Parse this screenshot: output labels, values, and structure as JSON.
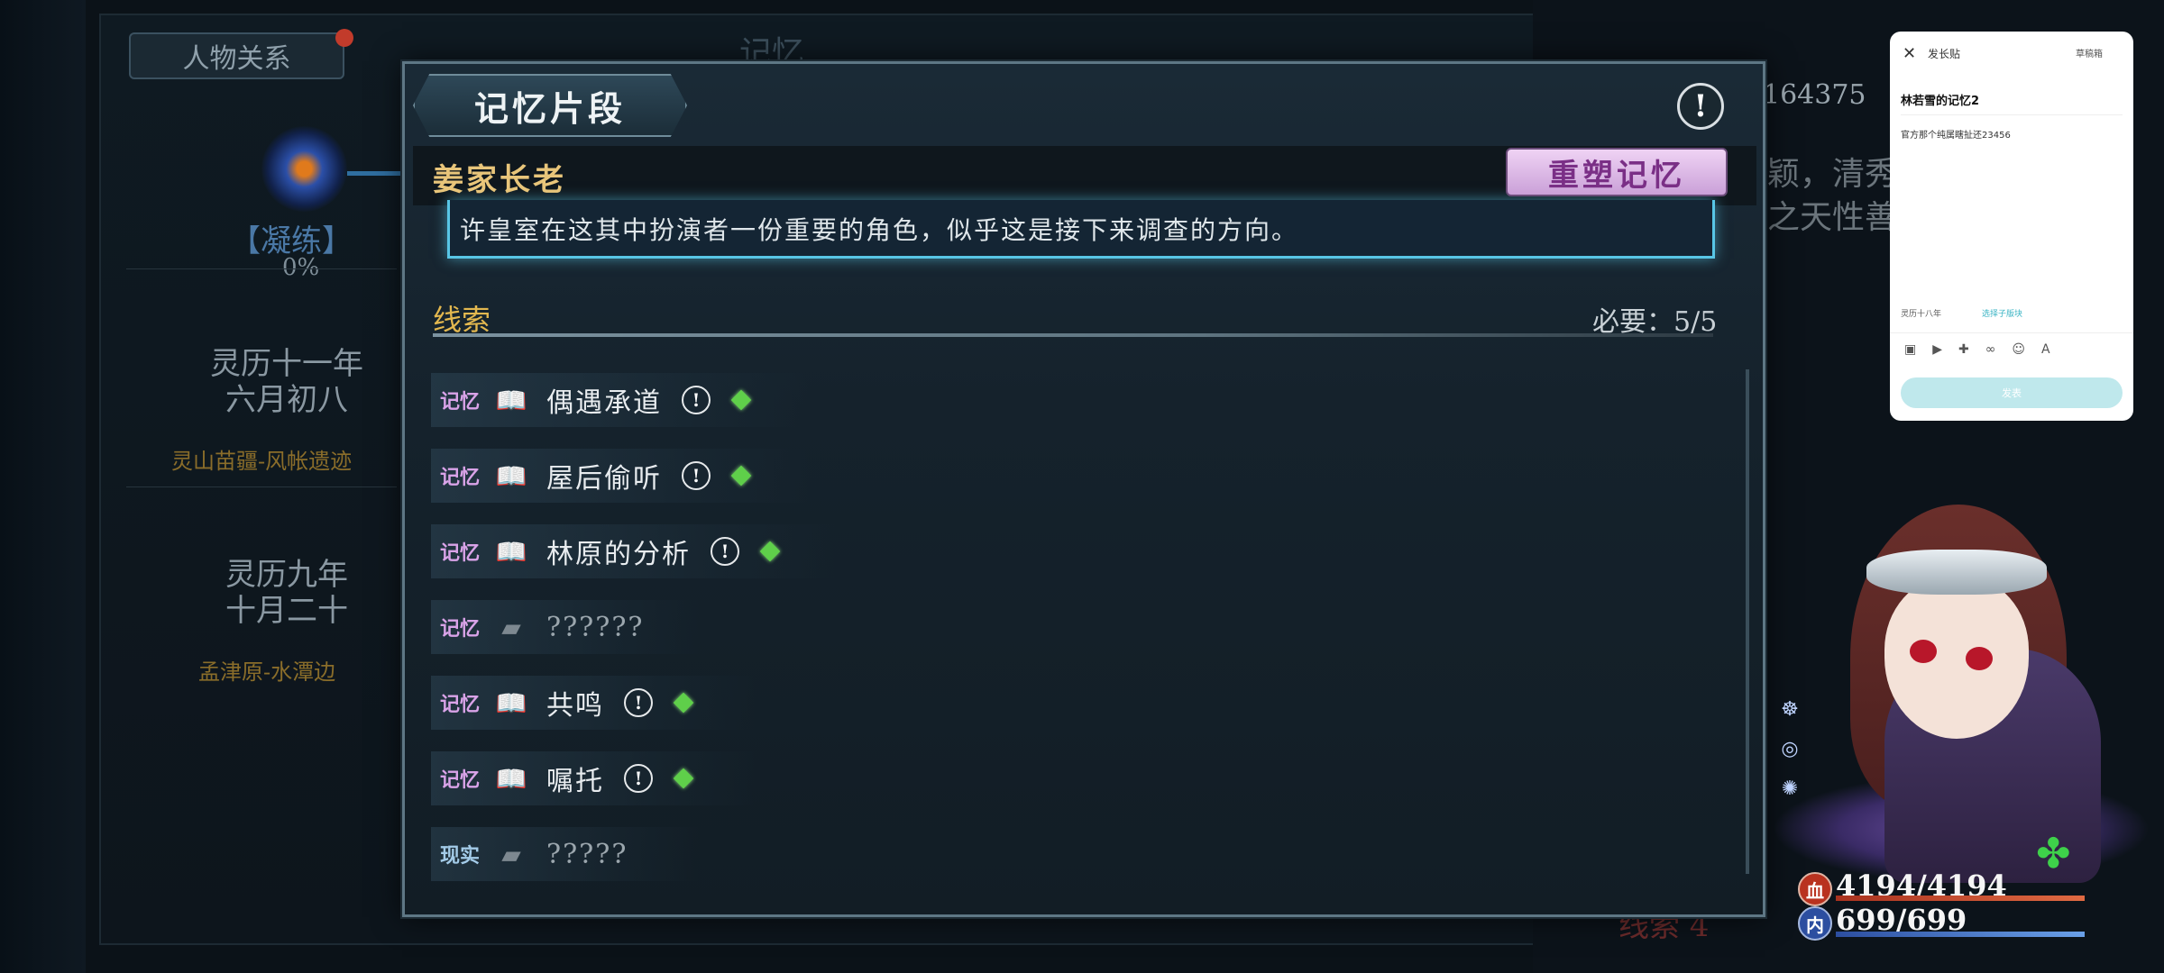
{
  "background": {
    "relations_tab": "人物关系",
    "title": "记忆",
    "condense_label": "【凝练】",
    "condense_percent": "0%",
    "events": [
      {
        "date_line1": "灵历十一年",
        "date_line2": "六月初八",
        "place": "灵山苗疆-风帐遗迹"
      },
      {
        "date_line1": "灵历九年",
        "date_line2": "十月二十",
        "place": "孟津原-水潭边"
      }
    ],
    "right_number": "164375",
    "right_text_line1": "颖，清秀",
    "right_text_line2": "之天性善",
    "bottom_hint": "线索 4"
  },
  "panel": {
    "title": "记忆片段",
    "info_symbol": "!",
    "npc_name": "姜家长老",
    "reshape_button": "重塑记忆",
    "description": "许皇室在这其中扮演者一份重要的角色，似乎这是接下来调查的方向。",
    "clues_title": "线索",
    "required": "必要：5/5",
    "clues": [
      {
        "tag": "记忆",
        "book_icon": "open-book-icon",
        "name": "偶遇承道",
        "known": true
      },
      {
        "tag": "记忆",
        "book_icon": "open-book-icon",
        "name": "屋后偷听",
        "known": true
      },
      {
        "tag": "记忆",
        "book_icon": "open-book-icon",
        "name": "林原的分析",
        "known": true
      },
      {
        "tag": "记忆",
        "book_icon": "closed-book-icon",
        "name": "??????",
        "known": false
      },
      {
        "tag": "记忆",
        "book_icon": "open-book-icon",
        "name": "共鸣",
        "known": true
      },
      {
        "tag": "记忆",
        "book_icon": "open-book-icon",
        "name": "嘱托",
        "known": true
      },
      {
        "tag": "现实",
        "book_icon": "closed-book-icon",
        "name": "?????",
        "known": false
      }
    ]
  },
  "popup": {
    "close": "✕",
    "header": "发长贴",
    "draft": "草稿箱",
    "heading": "林若雪的记忆2",
    "body": "官方那个纯属瞎扯还23456",
    "topic": "灵历十八年",
    "subforum": "选择子版块",
    "send": "发表"
  },
  "hud": {
    "hp_icon": "血",
    "mp_icon": "内",
    "hp": "4194/4194",
    "mp": "699/699"
  },
  "colors": {
    "panel_border": "#5e7785",
    "accent_gold": "#e3b84f",
    "desc_glow": "#58c6e6",
    "gem_green": "#5fcf4a",
    "reshape_bg": "#e9c9f0"
  }
}
